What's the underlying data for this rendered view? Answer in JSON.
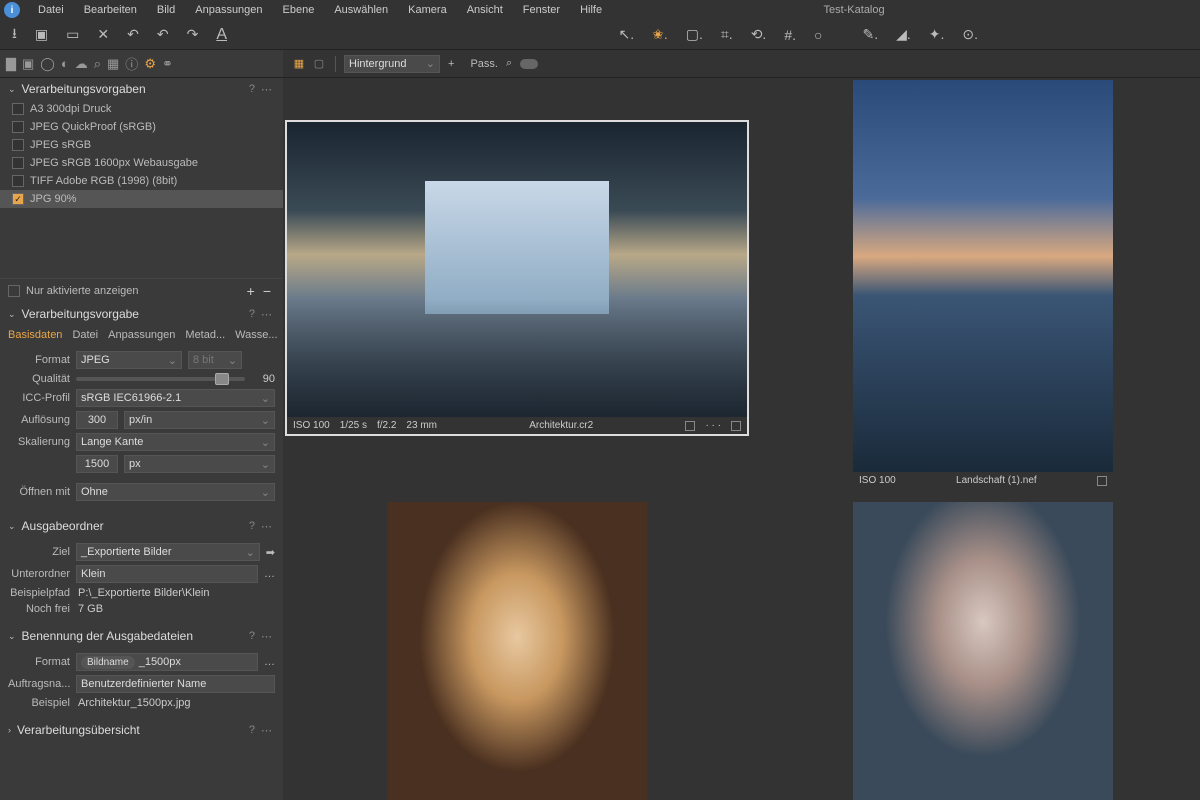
{
  "window": {
    "title": "Test-Katalog"
  },
  "menu": [
    "Datei",
    "Bearbeiten",
    "Bild",
    "Anpassungen",
    "Ebene",
    "Auswählen",
    "Kamera",
    "Ansicht",
    "Fenster",
    "Hilfe"
  ],
  "mainToolbar": {
    "backgroundSelectLabel": "Hintergrund",
    "passLabel": "Pass."
  },
  "presets": {
    "panelTitle": "Verarbeitungsvorgaben",
    "items": [
      {
        "label": "A3 300dpi Druck",
        "checked": false
      },
      {
        "label": "JPEG QuickProof (sRGB)",
        "checked": false
      },
      {
        "label": "JPEG sRGB",
        "checked": false
      },
      {
        "label": "JPEG sRGB 1600px Webausgabe",
        "checked": false
      },
      {
        "label": "TIFF Adobe RGB (1998) (8bit)",
        "checked": false
      },
      {
        "label": "JPG 90%",
        "checked": true
      }
    ],
    "onlyEnabledLabel": "Nur aktivierte anzeigen"
  },
  "recipe": {
    "panelTitle": "Verarbeitungsvorgabe",
    "tabs": [
      "Basisdaten",
      "Datei",
      "Anpassungen",
      "Metad...",
      "Wasse..."
    ],
    "formatLabel": "Format",
    "formatValue": "JPEG",
    "bitDepth": "8 bit",
    "qualityLabel": "Qualität",
    "qualityValue": "90",
    "iccLabel": "ICC-Profil",
    "iccValue": "sRGB IEC61966-2.1",
    "resLabel": "Auflösung",
    "resValue": "300",
    "resUnit": "px/in",
    "scaleLabel": "Skalierung",
    "scaleValue": "Lange Kante",
    "sizeValue": "1500",
    "sizeUnit": "px",
    "openLabel": "Öffnen mit",
    "openValue": "Ohne"
  },
  "output": {
    "panelTitle": "Ausgabeordner",
    "destLabel": "Ziel",
    "destValue": "_Exportierte Bilder",
    "subLabel": "Unterordner",
    "subValue": "Klein",
    "pathLabel": "Beispielpfad",
    "pathValue": "P:\\_Exportierte Bilder\\Klein",
    "freeLabel": "Noch frei",
    "freeValue": "7 GB"
  },
  "naming": {
    "panelTitle": "Benennung der Ausgabedateien",
    "formatLabel": "Format",
    "tokenImagename": "Bildname",
    "tokenSuffix": "_1500px",
    "jobLabel": "Auftragsna...",
    "jobValue": "Benutzerdefinierter Name",
    "exampleLabel": "Beispiel",
    "exampleValue": "Architektur_1500px.jpg"
  },
  "summary": {
    "panelTitle": "Verarbeitungsübersicht"
  },
  "thumbs": [
    {
      "iso": "ISO 100",
      "shutter": "1/25 s",
      "aperture": "f/2.2",
      "focal": "23 mm",
      "file": "Architektur.cr2"
    },
    {
      "iso": "ISO 100",
      "file": "Landschaft (1).nef"
    }
  ]
}
